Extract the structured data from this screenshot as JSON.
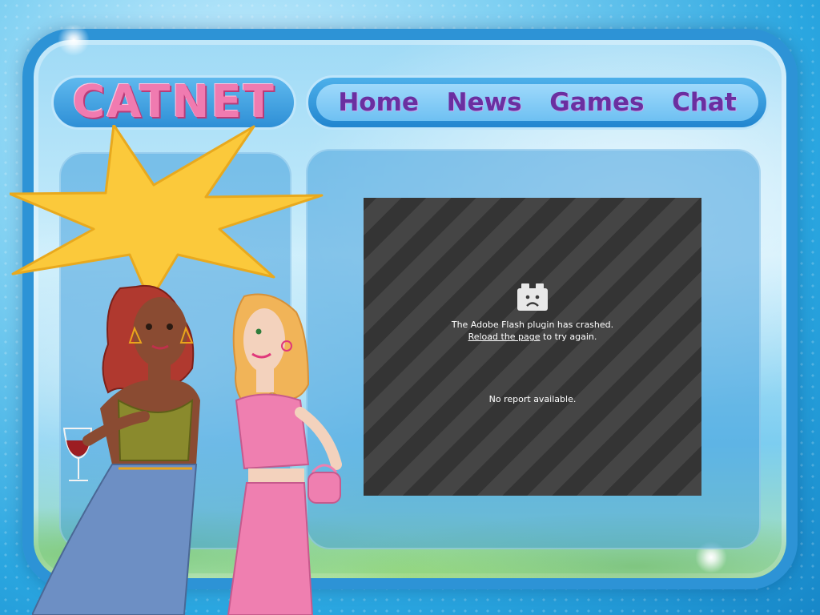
{
  "site": {
    "logo": "CATNET"
  },
  "nav": {
    "items": [
      "Home",
      "News",
      "Games",
      "Chat"
    ]
  },
  "plugin_error": {
    "message": "The Adobe Flash plugin has crashed.",
    "reload_link": "Reload the page",
    "reload_suffix": " to try again.",
    "no_report": "No report available.",
    "icon": "sad-puzzle-piece-icon"
  },
  "colors": {
    "logo_pink": "#f07bb0",
    "nav_purple": "#6a2fa0",
    "frame_blue": "#2d93d6",
    "starburst_yellow": "#fbc93b",
    "plugin_bg": "#3b3b3b"
  }
}
